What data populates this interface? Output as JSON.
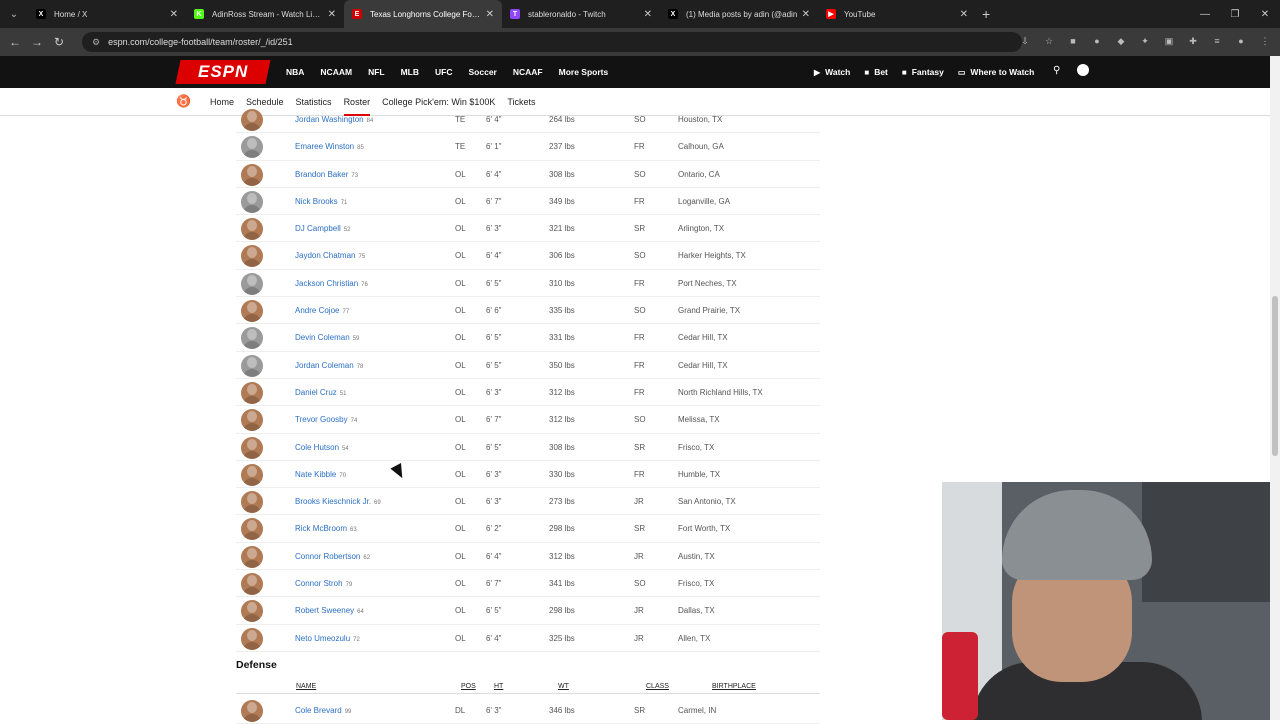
{
  "browser": {
    "tabs": [
      {
        "title": "Home / X",
        "fav": "X",
        "fav_color": "#000000",
        "active": false
      },
      {
        "title": "AdinRoss Stream - Watch Live on",
        "fav": "K",
        "fav_color": "#53fc18",
        "active": false
      },
      {
        "title": "Texas Longhorns College Footb",
        "fav": "E",
        "fav_color": "#d00000",
        "active": true
      },
      {
        "title": "stableronaldo - Twitch",
        "fav": "T",
        "fav_color": "#9146ff",
        "active": false
      },
      {
        "title": "(1) Media posts by adin (@adin",
        "fav": "X",
        "fav_color": "#000000",
        "active": false
      },
      {
        "title": "YouTube",
        "fav": "▶",
        "fav_color": "#ff0000",
        "active": false
      }
    ],
    "url": "espn.com/college-football/team/roster/_/id/251"
  },
  "espn": {
    "logo": "ESPN",
    "nav": [
      "NBA",
      "NCAAM",
      "NFL",
      "MLB",
      "UFC",
      "Soccer",
      "NCAAF",
      "More Sports"
    ],
    "right": [
      {
        "icon": "▶",
        "label": "Watch"
      },
      {
        "icon": "■",
        "label": "Bet"
      },
      {
        "icon": "■",
        "label": "Fantasy"
      },
      {
        "icon": "▭",
        "label": "Where to Watch"
      }
    ],
    "subnav": [
      "Home",
      "Schedule",
      "Statistics",
      "Roster",
      "College Pick'em: Win $100K",
      "Tickets"
    ],
    "active_subnav": "Roster"
  },
  "roster": {
    "offense_rows": [
      {
        "name": "Jordan Washington",
        "jersey": "84",
        "pos": "TE",
        "ht": "6' 4\"",
        "wt": "264 lbs",
        "cls": "SO",
        "bp": "Houston, TX",
        "photo": true
      },
      {
        "name": "Emaree Winston",
        "jersey": "85",
        "pos": "TE",
        "ht": "6' 1\"",
        "wt": "237 lbs",
        "cls": "FR",
        "bp": "Calhoun, GA",
        "photo": false
      },
      {
        "name": "Brandon Baker",
        "jersey": "73",
        "pos": "OL",
        "ht": "6' 4\"",
        "wt": "308 lbs",
        "cls": "SO",
        "bp": "Ontario, CA",
        "photo": true
      },
      {
        "name": "Nick Brooks",
        "jersey": "71",
        "pos": "OL",
        "ht": "6' 7\"",
        "wt": "349 lbs",
        "cls": "FR",
        "bp": "Loganville, GA",
        "photo": false
      },
      {
        "name": "DJ Campbell",
        "jersey": "52",
        "pos": "OL",
        "ht": "6' 3\"",
        "wt": "321 lbs",
        "cls": "SR",
        "bp": "Arlington, TX",
        "photo": true
      },
      {
        "name": "Jaydon Chatman",
        "jersey": "75",
        "pos": "OL",
        "ht": "6' 4\"",
        "wt": "306 lbs",
        "cls": "SO",
        "bp": "Harker Heights, TX",
        "photo": true
      },
      {
        "name": "Jackson Christian",
        "jersey": "76",
        "pos": "OL",
        "ht": "6' 5\"",
        "wt": "310 lbs",
        "cls": "FR",
        "bp": "Port Neches, TX",
        "photo": false
      },
      {
        "name": "Andre Cojoe",
        "jersey": "77",
        "pos": "OL",
        "ht": "6' 6\"",
        "wt": "335 lbs",
        "cls": "SO",
        "bp": "Grand Prairie, TX",
        "photo": true
      },
      {
        "name": "Devin Coleman",
        "jersey": "59",
        "pos": "OL",
        "ht": "6' 5\"",
        "wt": "331 lbs",
        "cls": "FR",
        "bp": "Cedar Hill, TX",
        "photo": false
      },
      {
        "name": "Jordan Coleman",
        "jersey": "78",
        "pos": "OL",
        "ht": "6' 5\"",
        "wt": "350 lbs",
        "cls": "FR",
        "bp": "Cedar Hill, TX",
        "photo": false
      },
      {
        "name": "Daniel Cruz",
        "jersey": "51",
        "pos": "OL",
        "ht": "6' 3\"",
        "wt": "312 lbs",
        "cls": "FR",
        "bp": "North Richland Hills, TX",
        "photo": true
      },
      {
        "name": "Trevor Goosby",
        "jersey": "74",
        "pos": "OL",
        "ht": "6' 7\"",
        "wt": "312 lbs",
        "cls": "SO",
        "bp": "Melissa, TX",
        "photo": true
      },
      {
        "name": "Cole Hutson",
        "jersey": "54",
        "pos": "OL",
        "ht": "6' 5\"",
        "wt": "308 lbs",
        "cls": "SR",
        "bp": "Frisco, TX",
        "photo": true
      },
      {
        "name": "Nate Kibble",
        "jersey": "70",
        "pos": "OL",
        "ht": "6' 3\"",
        "wt": "330 lbs",
        "cls": "FR",
        "bp": "Humble, TX",
        "photo": true
      },
      {
        "name": "Brooks Kieschnick Jr.",
        "jersey": "69",
        "pos": "OL",
        "ht": "6' 3\"",
        "wt": "273 lbs",
        "cls": "JR",
        "bp": "San Antonio, TX",
        "photo": true
      },
      {
        "name": "Rick McBroom",
        "jersey": "63",
        "pos": "OL",
        "ht": "6' 2\"",
        "wt": "298 lbs",
        "cls": "SR",
        "bp": "Fort Worth, TX",
        "photo": true
      },
      {
        "name": "Connor Robertson",
        "jersey": "62",
        "pos": "OL",
        "ht": "6' 4\"",
        "wt": "312 lbs",
        "cls": "JR",
        "bp": "Austin, TX",
        "photo": true
      },
      {
        "name": "Connor Stroh",
        "jersey": "79",
        "pos": "OL",
        "ht": "6' 7\"",
        "wt": "341 lbs",
        "cls": "SO",
        "bp": "Frisco, TX",
        "photo": true
      },
      {
        "name": "Robert Sweeney",
        "jersey": "64",
        "pos": "OL",
        "ht": "6' 5\"",
        "wt": "298 lbs",
        "cls": "JR",
        "bp": "Dallas, TX",
        "photo": true
      },
      {
        "name": "Neto Umeozulu",
        "jersey": "72",
        "pos": "OL",
        "ht": "6' 4\"",
        "wt": "325 lbs",
        "cls": "JR",
        "bp": "Allen, TX",
        "photo": true
      }
    ],
    "defense_title": "Defense",
    "headers": {
      "name": "NAME",
      "pos": "POS",
      "ht": "HT",
      "wt": "WT",
      "cls": "CLASS",
      "bp": "BIRTHPLACE"
    },
    "defense_rows": [
      {
        "name": "Cole Brevard",
        "jersey": "99",
        "pos": "DL",
        "ht": "6' 3\"",
        "wt": "346 lbs",
        "cls": "SR",
        "bp": "Carmel, IN",
        "photo": true
      }
    ]
  }
}
